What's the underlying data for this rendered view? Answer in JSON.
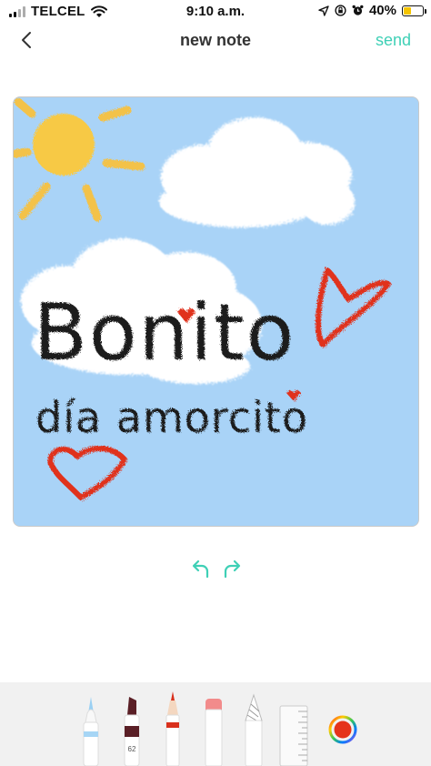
{
  "status_bar": {
    "carrier": "TELCEL",
    "time": "9:10 a.m.",
    "battery_text": "40%",
    "battery_level": 0.4,
    "icons": [
      "signal-icon",
      "wifi-icon",
      "location-arrow-icon",
      "screen-lock-icon",
      "alarm-icon",
      "battery-icon"
    ]
  },
  "nav": {
    "title": "new note",
    "send_label": "send",
    "back_icon": "chevron-left-icon"
  },
  "canvas": {
    "background_color": "#a9d3f7",
    "handwriting_line1": "Bonito",
    "handwriting_line2": "día amorcito",
    "ink_color": "#1a1a1a",
    "heart_color": "#e0311f",
    "sun_color": "#f7c944"
  },
  "history": {
    "undo_icon": "undo-arrow-icon",
    "redo_icon": "redo-arrow-icon",
    "accent_color": "#3fd0b6"
  },
  "toolbar": {
    "tools": [
      "pen-blue",
      "marker-dark",
      "pencil-red",
      "eraser",
      "fountain-pen",
      "ruler"
    ],
    "marker_label": "62",
    "selected_color": "#e5331b"
  }
}
